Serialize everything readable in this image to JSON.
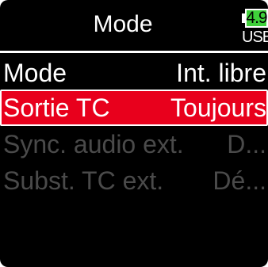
{
  "header": {
    "title": "Mode",
    "battery": {
      "value": "4.9",
      "source": "USB",
      "icon": "battery-icon",
      "fill_color": "#3fd13a"
    }
  },
  "menu": {
    "items": [
      {
        "label": "Mode",
        "value": "Int. libre",
        "state": "normal"
      },
      {
        "label": "Sortie TC",
        "value": "Toujours",
        "state": "selected"
      },
      {
        "label": "Sync. audio ext.",
        "value": "D...",
        "state": "disabled"
      },
      {
        "label": "Subst. TC ext.",
        "value": "Dé...",
        "state": "disabled"
      }
    ]
  },
  "colors": {
    "background": "#000000",
    "selection": "#e8001c",
    "text": "#ffffff",
    "disabled_text": "#4a4a4a"
  }
}
